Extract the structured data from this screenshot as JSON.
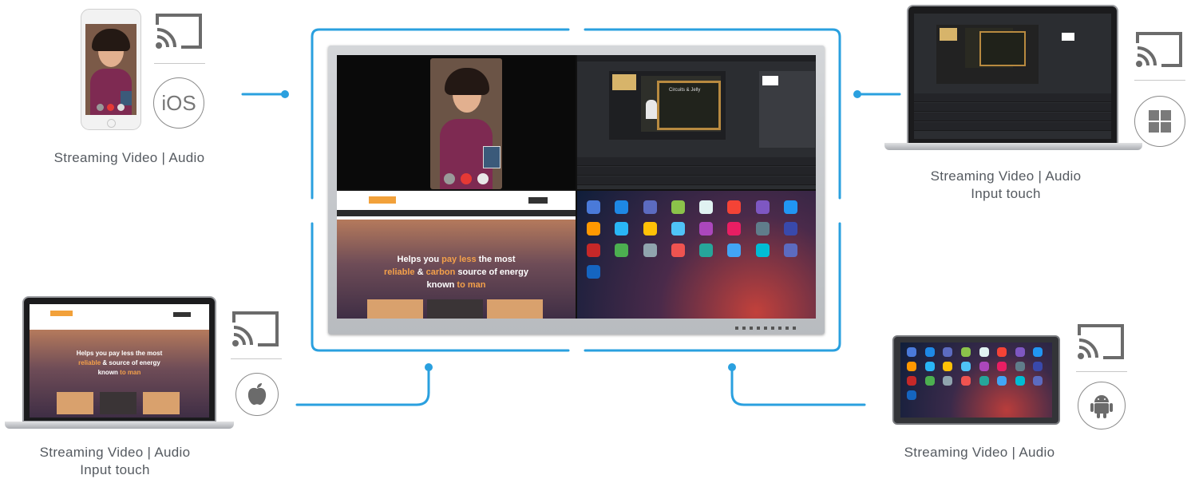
{
  "devices": {
    "iphone": {
      "caption_line1": "Streaming Video | Audio",
      "os": "iOS",
      "os_icon": "ios-icon"
    },
    "windows_laptop": {
      "caption_line1": "Streaming Video | Audio",
      "caption_line2": "Input touch",
      "os_icon": "windows-icon"
    },
    "mac_laptop": {
      "caption_line1": "Streaming Video | Audio",
      "caption_line2": "Input touch",
      "os_icon": "apple-icon"
    },
    "android_tablet": {
      "caption_line1": "Streaming Video | Audio",
      "os_icon": "android-icon"
    }
  },
  "website": {
    "hero_line1_a": "Helps you",
    "hero_line1_b": "pay less",
    "hero_line1_c": "the most",
    "hero_line2_a": "reliable",
    "hero_line2_b": "&",
    "hero_line2_c": "carbon",
    "hero_line2_d": "source of energy",
    "hero_line3_a": "known",
    "hero_line3_b": "to man"
  },
  "video_slide": {
    "title": "Circuits & Jelly"
  },
  "colors": {
    "accent": "#2aa0df",
    "icon_gray": "#6b6b6b",
    "text_gray": "#555a60",
    "web_orange": "#f3a04a"
  },
  "icons": [
    "cast-icon",
    "ios-icon",
    "windows-icon",
    "apple-icon",
    "android-icon"
  ]
}
